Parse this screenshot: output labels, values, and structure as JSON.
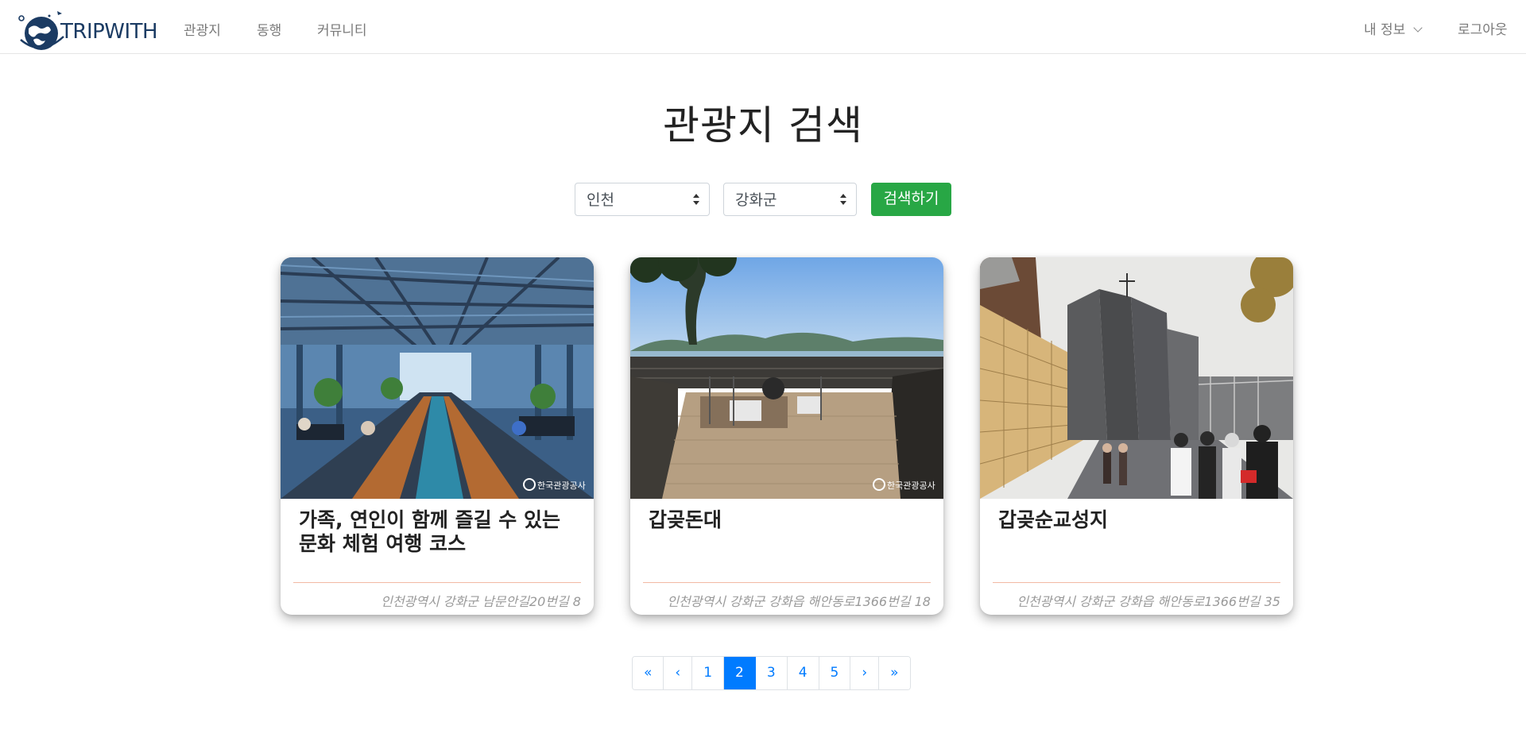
{
  "navbar": {
    "logo_text": "TRIPWITH",
    "links": [
      "관광지",
      "동행",
      "커뮤니티"
    ],
    "my_info": "내 정보",
    "logout": "로그아웃"
  },
  "page": {
    "title": "관광지 검색"
  },
  "search": {
    "region_selected": "인천",
    "district_selected": "강화군",
    "button_label": "검색하기"
  },
  "cards": [
    {
      "title": "가족, 연인이 함께 즐길 수 있는 문화 체험 여행 코스",
      "address": "인천광역시 강화군 남문안길20번길 8",
      "watermark": "한국관광공사"
    },
    {
      "title": "갑곶돈대",
      "address": "인천광역시 강화군 강화읍 해안동로1366번길 18",
      "watermark": "한국관광공사"
    },
    {
      "title": "갑곶순교성지",
      "address": "인천광역시 강화군 강화읍 해안동로1366번길 35"
    }
  ],
  "pagination": {
    "first": "«",
    "prev": "‹",
    "pages": [
      "1",
      "2",
      "3",
      "4",
      "5"
    ],
    "current": "2",
    "next": "›",
    "last": "»"
  },
  "colors": {
    "primary": "#007bff",
    "success": "#28a745",
    "logo": "#1b3b63",
    "divider": "#f2b9a4"
  }
}
